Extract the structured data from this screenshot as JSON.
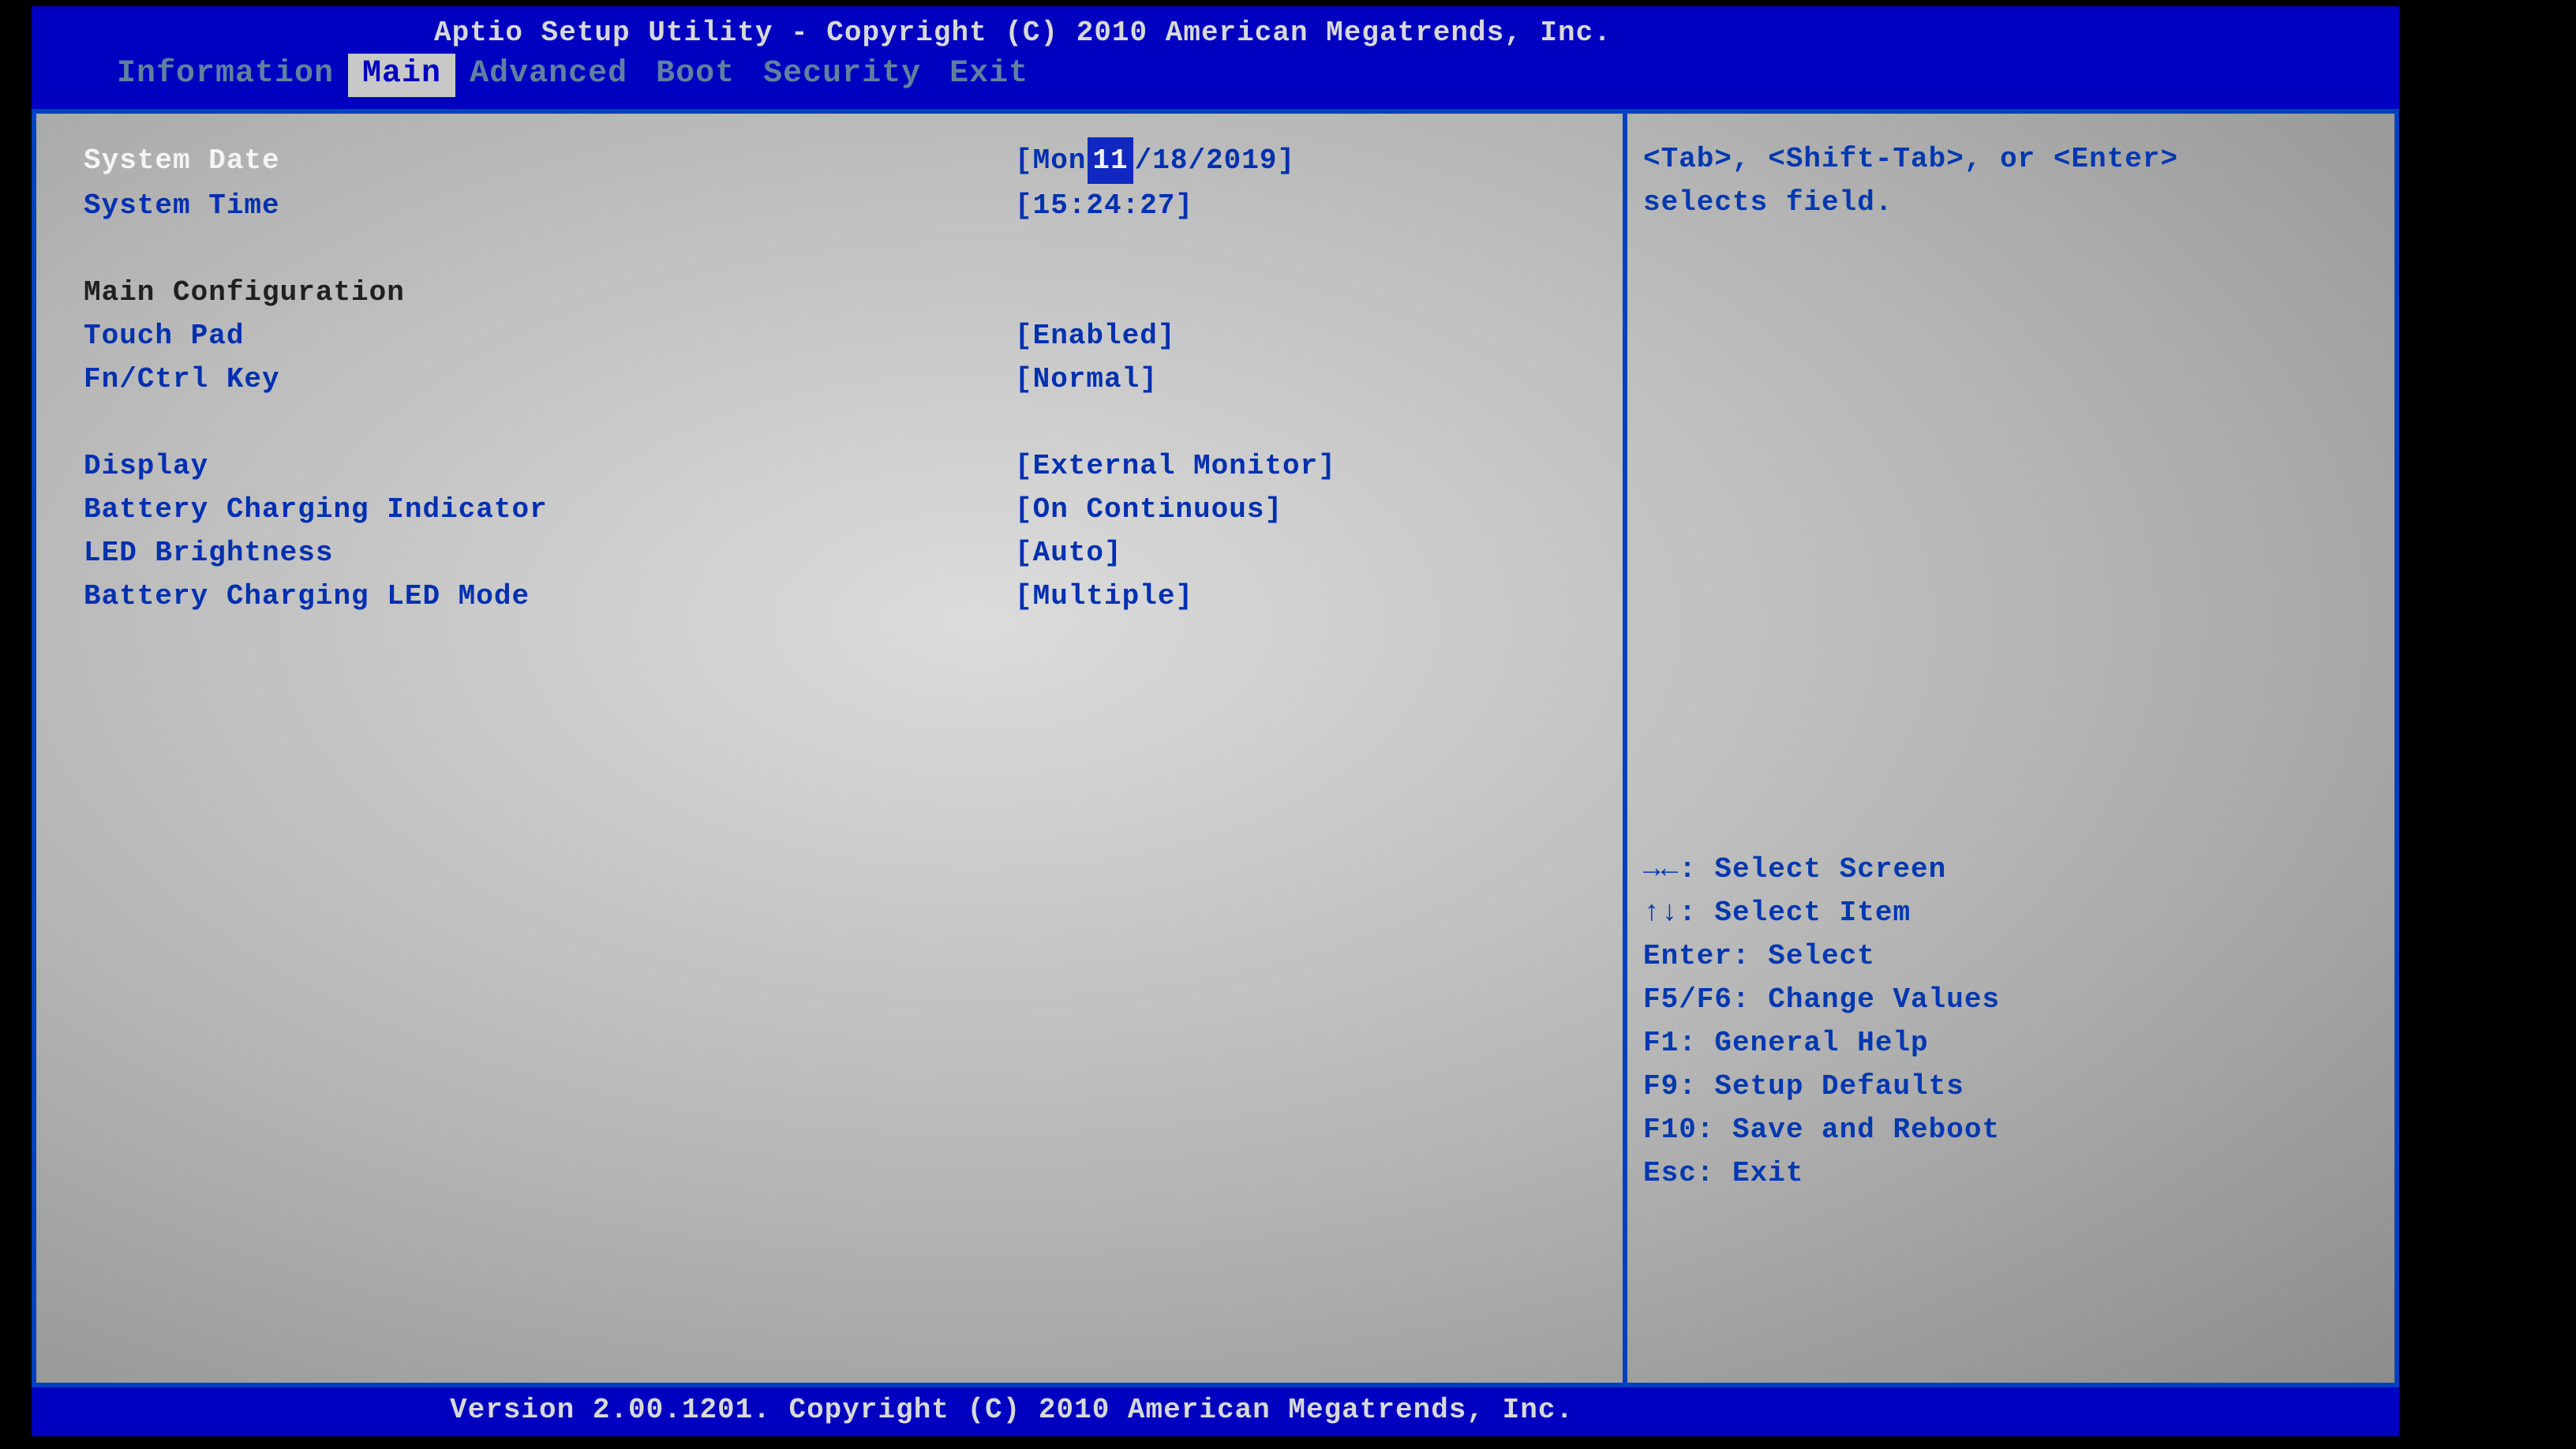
{
  "header": {
    "title": "Aptio Setup Utility - Copyright (C) 2010 American Megatrends, Inc.",
    "tabs": [
      "Information",
      "Main",
      "Advanced",
      "Boot",
      "Security",
      "Exit"
    ],
    "active_tab_index": 1
  },
  "main": {
    "system_date_label": "System Date",
    "system_date_value_prefix": "[Mon ",
    "system_date_month": "11",
    "system_date_value_suffix": "/18/2019]",
    "system_time_label": "System Time",
    "system_time_value": "[15:24:27]",
    "section_title": "Main Configuration",
    "items": [
      {
        "label": "Touch Pad",
        "value": "[Enabled]"
      },
      {
        "label": "Fn/Ctrl Key",
        "value": "[Normal]"
      }
    ],
    "items2": [
      {
        "label": "Display",
        "value": "[External Monitor]"
      },
      {
        "label": "Battery Charging Indicator",
        "value": "[On Continuous]"
      },
      {
        "label": "LED Brightness",
        "value": "[Auto]"
      },
      {
        "label": "Battery Charging LED Mode",
        "value": "[Multiple]"
      }
    ]
  },
  "help": {
    "top_line1": "<Tab>, <Shift-Tab>, or <Enter>",
    "top_line2": "selects field.",
    "keys": [
      "→←: Select Screen",
      "↑↓: Select Item",
      "Enter: Select",
      "F5/F6: Change Values",
      "F1: General Help",
      "F9: Setup Defaults",
      "F10: Save and Reboot",
      "Esc: Exit"
    ]
  },
  "footer": {
    "text": "Version 2.00.1201. Copyright (C) 2010 American Megatrends, Inc."
  }
}
